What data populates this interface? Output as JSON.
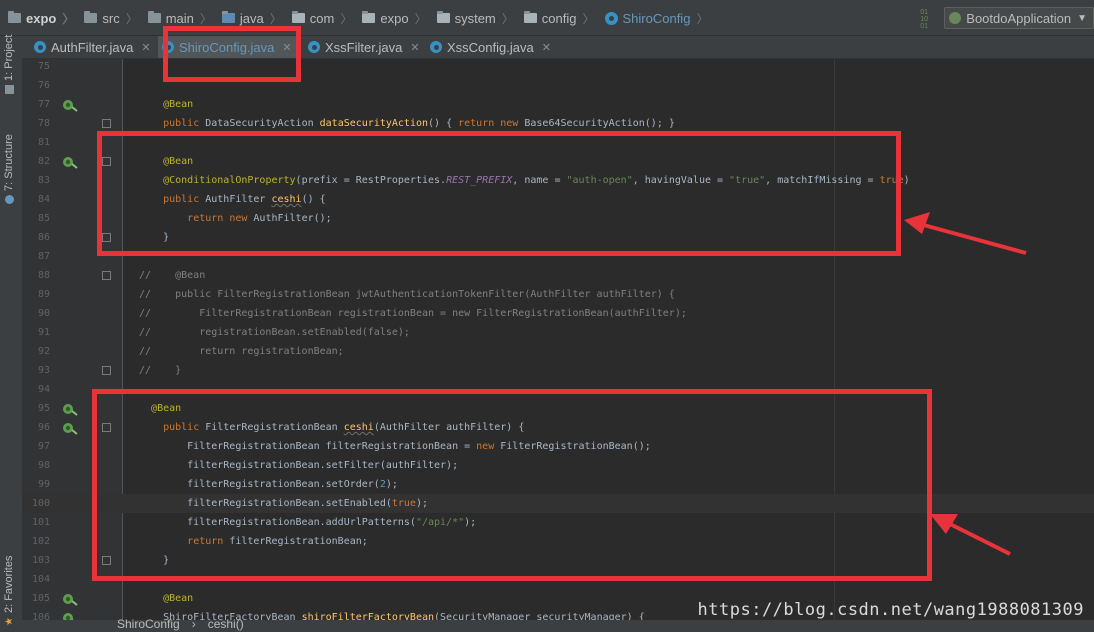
{
  "breadcrumbs": [
    {
      "label": "expo",
      "icon": "project-folder-icon",
      "bold": true
    },
    {
      "label": "src",
      "icon": "folder-icon"
    },
    {
      "label": "main",
      "icon": "folder-icon"
    },
    {
      "label": "java",
      "icon": "source-folder-icon"
    },
    {
      "label": "com",
      "icon": "package-icon"
    },
    {
      "label": "expo",
      "icon": "package-icon"
    },
    {
      "label": "system",
      "icon": "package-icon"
    },
    {
      "label": "config",
      "icon": "package-icon"
    },
    {
      "label": "ShiroConfig",
      "icon": "class-icon"
    }
  ],
  "run_config": {
    "label": "BootdoApplication",
    "icon": "spring-boot-icon"
  },
  "left_tool_tabs": [
    {
      "label": "1: Project"
    },
    {
      "label": "7: Structure"
    },
    {
      "label": "2: Favorites"
    }
  ],
  "tabs": [
    {
      "label": "AuthFilter.java",
      "active": false
    },
    {
      "label": "ShiroConfig.java",
      "active": true
    },
    {
      "label": "XssFilter.java",
      "active": false
    },
    {
      "label": "XssConfig.java",
      "active": false
    }
  ],
  "code_lines": [
    {
      "n": "75",
      "html": ""
    },
    {
      "n": "76",
      "html": ""
    },
    {
      "n": "77",
      "html": "    <span class='ann'>@Bean</span>"
    },
    {
      "n": "78",
      "html": "    <span class='kw'>public</span> DataSecurityAction <span class='fn'>dataSecurityAction</span>() { <span class='kw'>return new</span> Base64SecurityAction(); }"
    },
    {
      "n": "81",
      "html": ""
    },
    {
      "n": "82",
      "html": "    <span class='ann'>@Bean</span>"
    },
    {
      "n": "83",
      "html": "    <span class='ann'>@ConditionalOnProperty</span>(prefix = RestProperties.<span class='fld'>REST_PREFIX</span>, name = <span class='str'>\"auth-open\"</span>, havingValue = <span class='str'>\"true\"</span>, matchIfMissing = <span class='kw'>true</span>)"
    },
    {
      "n": "84",
      "html": "    <span class='kw'>public</span> AuthFilter <span class='fn und'>ceshi</span>() {"
    },
    {
      "n": "85",
      "html": "        <span class='kw'>return new</span> AuthFilter();"
    },
    {
      "n": "86",
      "html": "    }"
    },
    {
      "n": "87",
      "html": ""
    },
    {
      "n": "88",
      "html": "<span class='cmt'>//    @Bean</span>"
    },
    {
      "n": "89",
      "html": "<span class='cmt'>//    public FilterRegistrationBean jwtAuthenticationTokenFilter(AuthFilter authFilter) {</span>"
    },
    {
      "n": "90",
      "html": "<span class='cmt'>//        FilterRegistrationBean registrationBean = new FilterRegistrationBean(authFilter);</span>"
    },
    {
      "n": "91",
      "html": "<span class='cmt'>//        registrationBean.setEnabled(false);</span>"
    },
    {
      "n": "92",
      "html": "<span class='cmt'>//        return registrationBean;</span>"
    },
    {
      "n": "93",
      "html": "<span class='cmt'>//    }</span>"
    },
    {
      "n": "94",
      "html": ""
    },
    {
      "n": "95",
      "html": "  <span class='ann'>@Bean</span>"
    },
    {
      "n": "96",
      "html": "    <span class='kw'>public</span> FilterRegistrationBean <span class='fn und'>ceshi</span>(AuthFilter authFilter) {"
    },
    {
      "n": "97",
      "html": "        FilterRegistrationBean filterRegistrationBean = <span class='kw'>new</span> FilterRegistrationBean();"
    },
    {
      "n": "98",
      "html": "        filterRegistrationBean.setFilter(authFilter);"
    },
    {
      "n": "99",
      "html": "        filterRegistrationBean.setOrder(<span class='num'>2</span>);"
    },
    {
      "n": "100",
      "html": "        filterRegistrationBean.setEnabled(<span class='kw'>true</span>);"
    },
    {
      "n": "101",
      "html": "        filterRegistrationBean.addUrlPatterns(<span class='str'>\"/api/*\"</span>);"
    },
    {
      "n": "102",
      "html": "        <span class='kw'>return</span> filterRegistrationBean;"
    },
    {
      "n": "103",
      "html": "    }"
    },
    {
      "n": "104",
      "html": ""
    },
    {
      "n": "105",
      "html": "    <span class='ann'>@Bean</span>"
    },
    {
      "n": "106",
      "html": "    ShiroFilterFactoryBean <span class='fn'>shiroFilterFactoryBean</span>(SecurityManager securityManager) {"
    }
  ],
  "status_breadcrumbs": [
    "ShiroConfig",
    "ceshi()"
  ],
  "watermark": "https://blog.csdn.net/wang1988081309",
  "colors": {
    "annotation_red": "#e8333a",
    "keyword": "#cc7832",
    "annotation": "#bbb529",
    "string": "#6a8759"
  }
}
